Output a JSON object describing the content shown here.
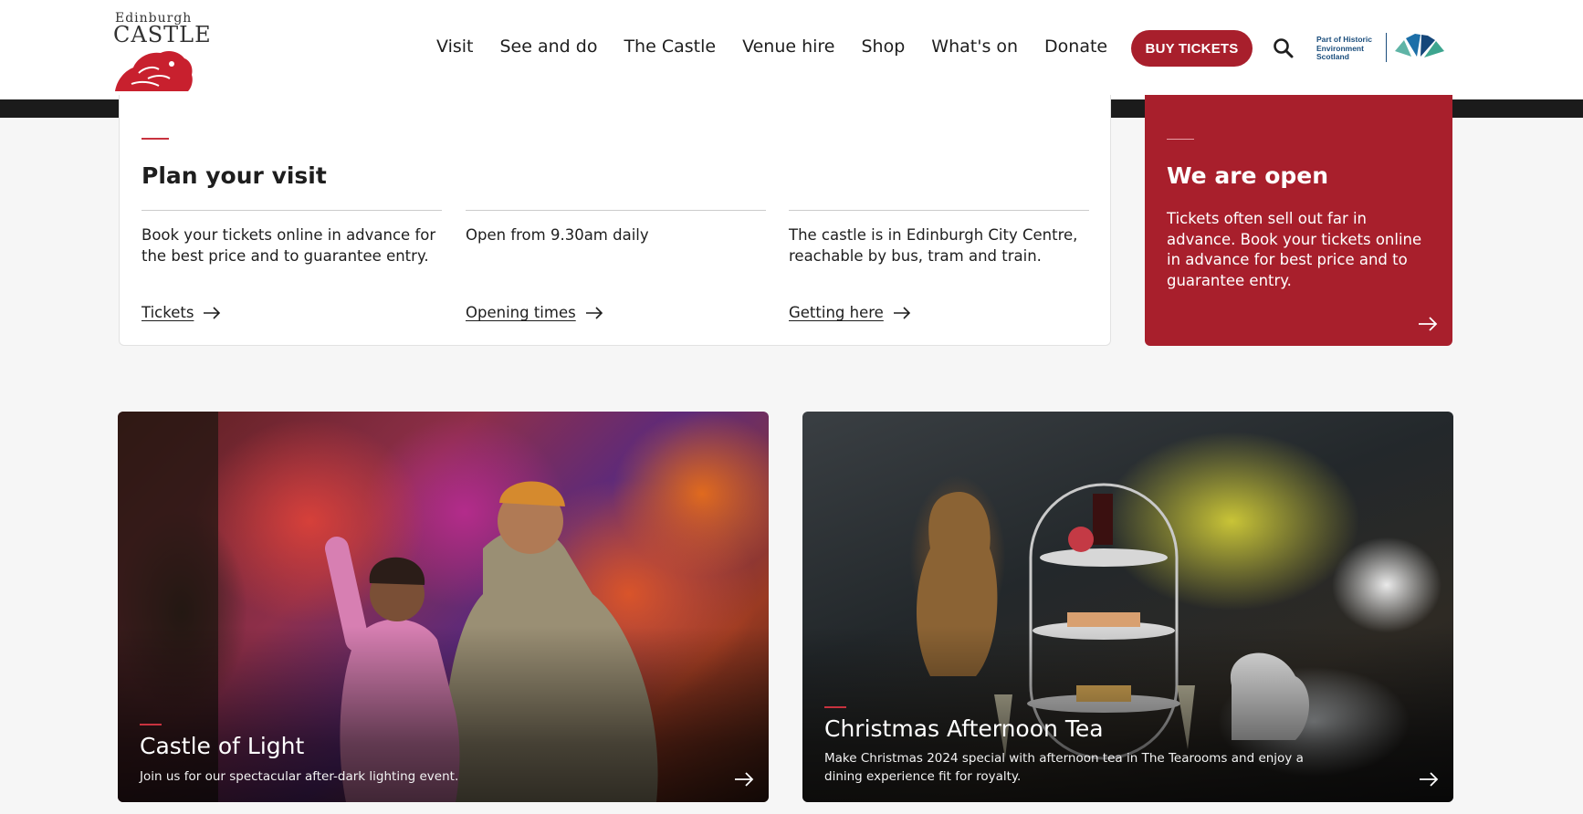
{
  "brand": {
    "logo_line1": "Edinburgh",
    "logo_line2": "CASTLE",
    "partner_text": "Part of Historic Environment Scotland",
    "colors": {
      "primary_red": "#a81f2c",
      "accent_red": "#c8323e",
      "text": "#1e1e1e",
      "background": "#f6f6f6"
    }
  },
  "nav": {
    "items": [
      "Visit",
      "See and do",
      "The Castle",
      "Venue hire",
      "Shop",
      "What's on",
      "Donate"
    ],
    "buy_tickets": "BUY TICKETS",
    "search_icon": "search-icon"
  },
  "plan": {
    "title": "Plan your visit",
    "columns": [
      {
        "text": "Book your tickets online in advance for the best price and to guarantee entry.",
        "link": "Tickets"
      },
      {
        "text": "Open from 9.30am daily",
        "link": "Opening times"
      },
      {
        "text": "The castle is in Edinburgh City Centre, reachable by bus, tram and train.",
        "link": "Getting here"
      }
    ]
  },
  "open_card": {
    "title": "We are open",
    "text": "Tickets often sell out far in advance. Book your tickets online in advance for best price and to guarantee entry."
  },
  "promos": [
    {
      "title": "Castle of Light",
      "text": "Join us for our spectacular after-dark lighting event."
    },
    {
      "title": "Christmas Afternoon Tea",
      "text": "Make Christmas 2024 special with afternoon tea in The Tearooms and enjoy a dining experience fit for royalty."
    }
  ]
}
